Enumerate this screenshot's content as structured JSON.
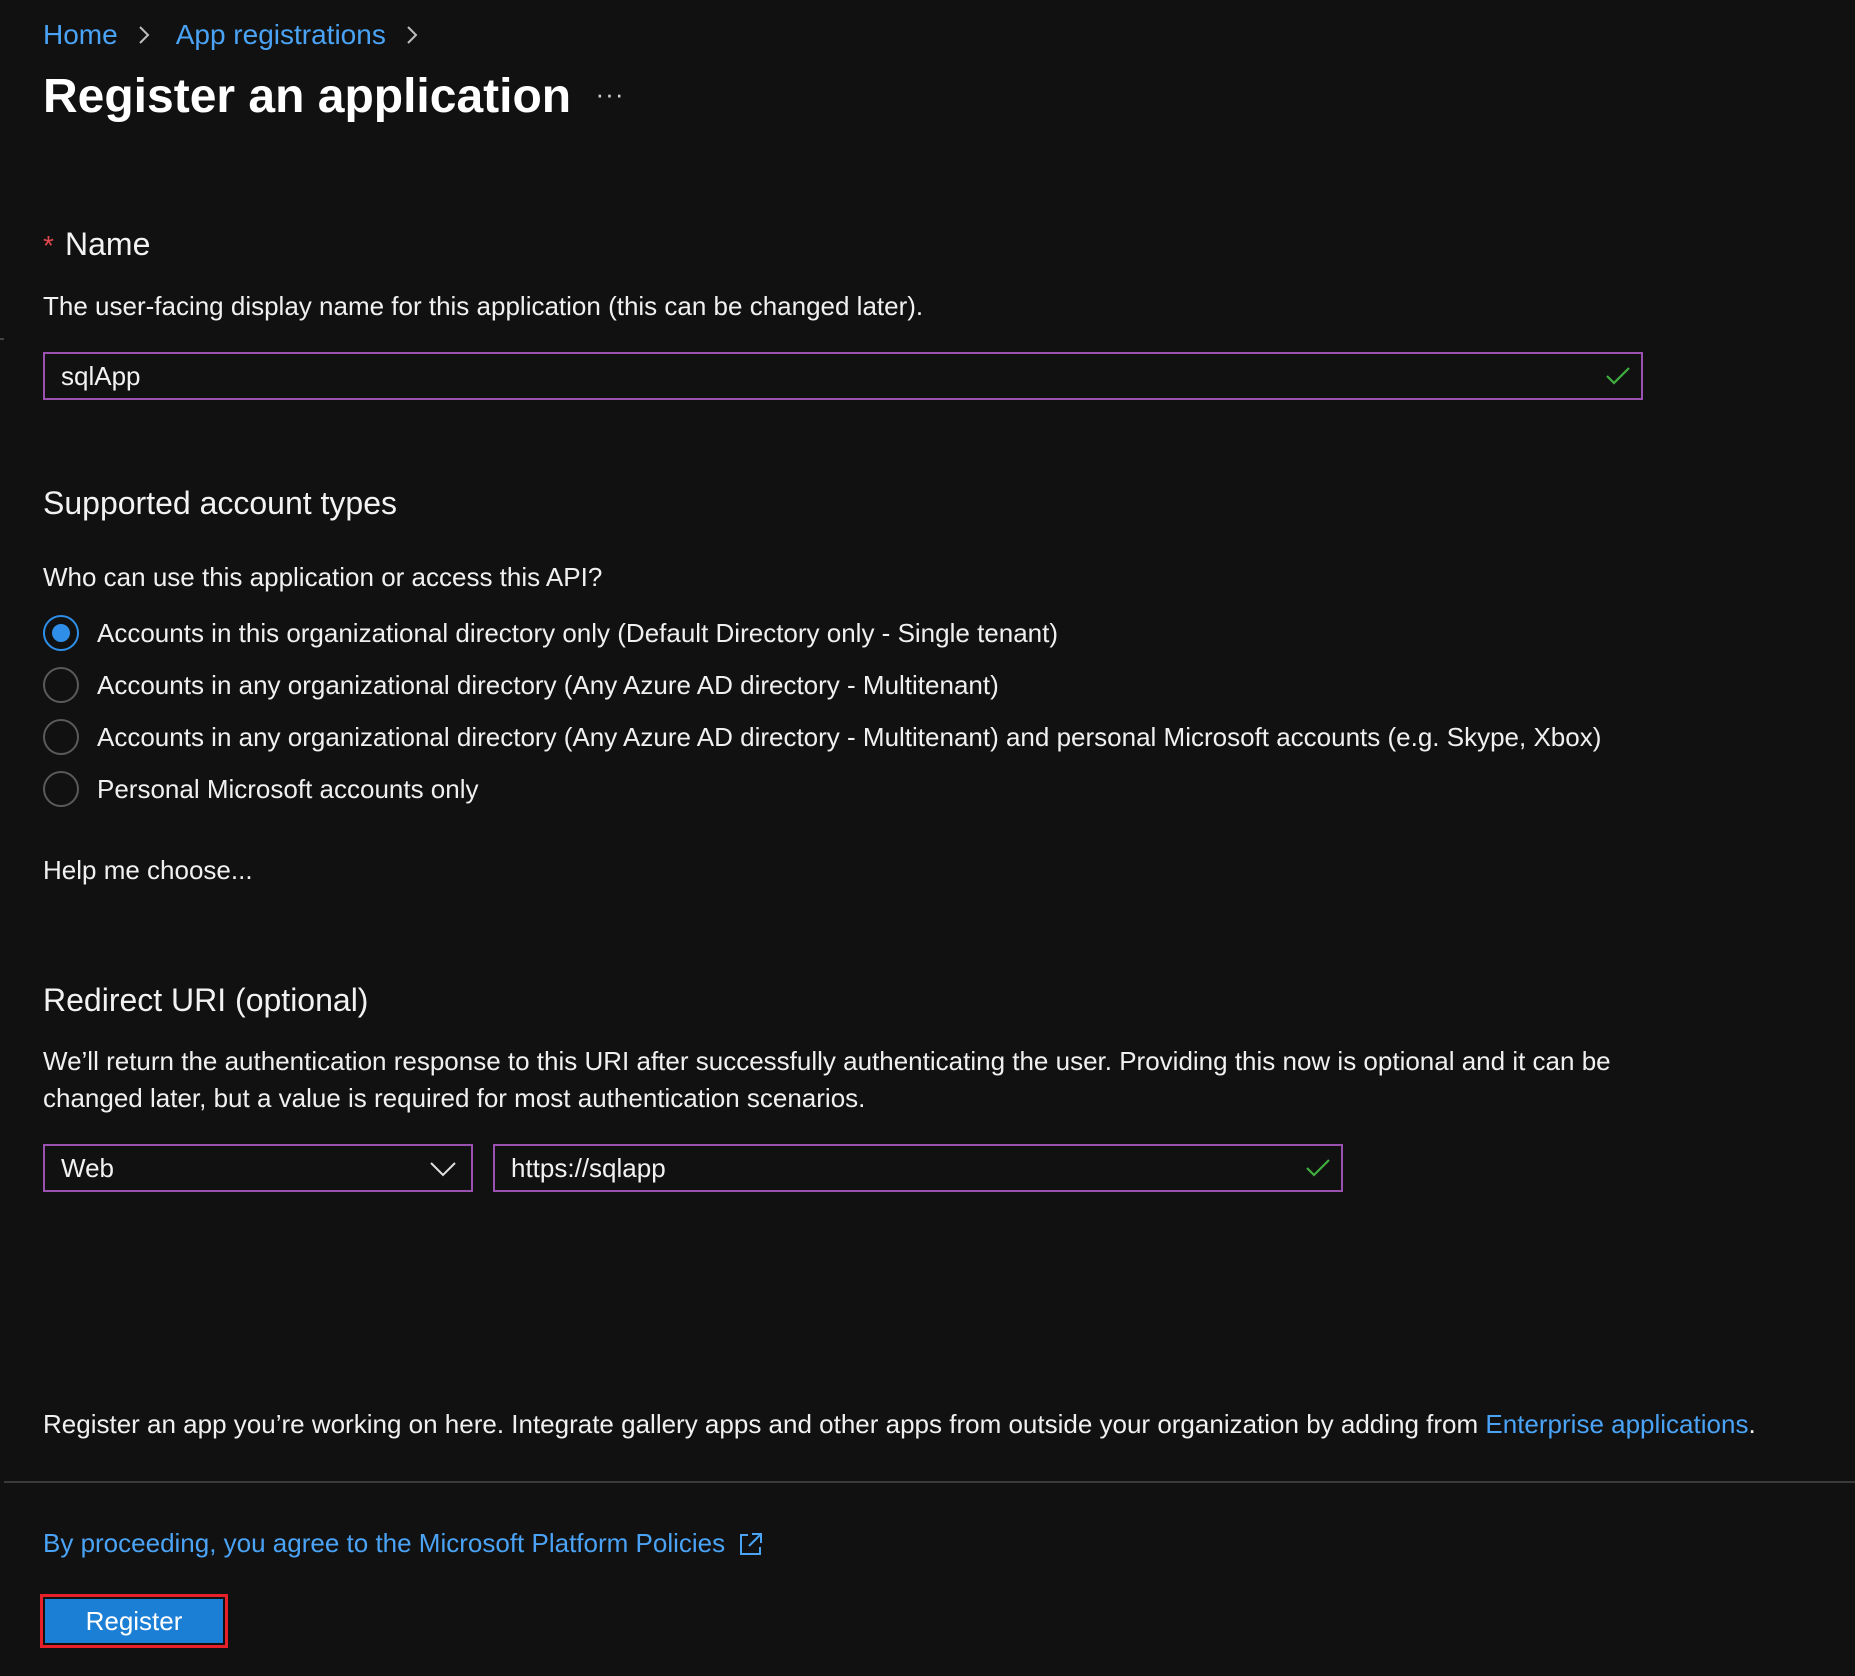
{
  "breadcrumb": {
    "items": [
      "Home",
      "App registrations"
    ]
  },
  "page": {
    "title": "Register an application",
    "more_label": "···"
  },
  "name_section": {
    "required_marker": "*",
    "label": "Name",
    "description": "The user-facing display name for this application (this can be changed later).",
    "value": "sqlApp"
  },
  "account_types": {
    "heading": "Supported account types",
    "question": "Who can use this application or access this API?",
    "options": [
      {
        "label": "Accounts in this organizational directory only (Default Directory only - Single tenant)",
        "selected": true
      },
      {
        "label": "Accounts in any organizational directory (Any Azure AD directory - Multitenant)",
        "selected": false
      },
      {
        "label": "Accounts in any organizational directory (Any Azure AD directory - Multitenant) and personal Microsoft accounts (e.g. Skype, Xbox)",
        "selected": false
      },
      {
        "label": "Personal Microsoft accounts only",
        "selected": false
      }
    ],
    "help_link": "Help me choose..."
  },
  "redirect": {
    "heading": "Redirect URI (optional)",
    "description_line1": "We’ll return the authentication response to this URI after successfully authenticating the user. Providing this now is optional and it can be",
    "description_line2": "changed later, but a value is required for most authentication scenarios.",
    "platform_value": "Web",
    "uri_value": "https://sqlapp"
  },
  "footer": {
    "note_prefix": "Register an app you’re working on here. Integrate gallery apps and other apps from outside your organization by adding from ",
    "note_link": "Enterprise applications",
    "note_suffix": ".",
    "policy_link": "By proceeding, you agree to the Microsoft Platform Policies",
    "register_label": "Register"
  },
  "colors": {
    "background": "#111111",
    "link": "#4aa3f5",
    "input_border": "#9a51b0",
    "check": "#3fae3f",
    "primary_button": "#1c7fd6",
    "highlight_outline": "#e8202a",
    "required": "#e2484d"
  },
  "icons": {
    "breadcrumb_separator": "chevron-right-icon",
    "valid": "checkmark-icon",
    "dropdown": "chevron-down-icon",
    "external": "external-link-icon"
  }
}
